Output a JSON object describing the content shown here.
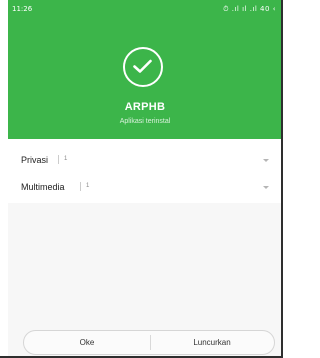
{
  "status_bar": {
    "time": "11:26",
    "icons_text": "⏱ .ıl ıl .ıl 40 ‹"
  },
  "app": {
    "name": "ARPHB",
    "status": "Aplikasi terinstal"
  },
  "permissions": [
    {
      "label": "Privasi",
      "count": "1"
    },
    {
      "label": "Multimedia",
      "count": "1"
    }
  ],
  "buttons": {
    "ok": "Oke",
    "launch": "Luncurkan"
  },
  "colors": {
    "header_green": "#3cb54a",
    "background": "#f7f7f7"
  },
  "icons": {
    "success": "check-circle-icon",
    "expand": "chevron-down-icon"
  }
}
